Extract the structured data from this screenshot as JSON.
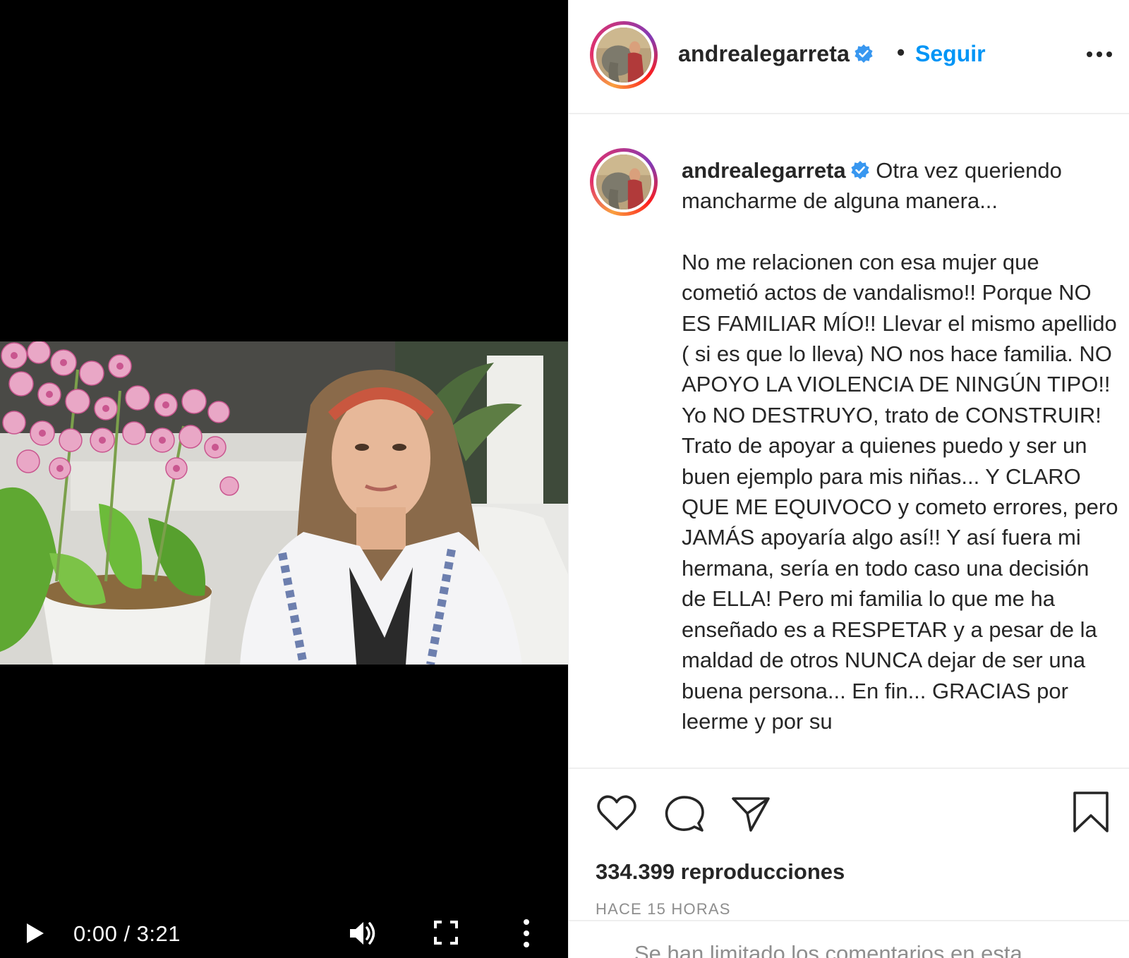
{
  "video": {
    "current_time": "0:00",
    "duration": "3:21",
    "time_display": "0:00 / 3:21",
    "controls": {
      "play_icon": "play-icon",
      "volume_icon": "volume-icon",
      "fullscreen_icon": "fullscreen-icon",
      "more_icon": "more-vertical-icon"
    }
  },
  "header": {
    "username": "andrealegarreta",
    "separator": "•",
    "follow_label": "Seguir",
    "more_icon": "more-horizontal-icon"
  },
  "caption": {
    "username": "andrealegarreta",
    "lead": " Otra vez queriendo mancharme de alguna manera...",
    "body": "No me relacionen con esa mujer que cometió actos de vandalismo!! Porque NO ES FAMILIAR MÍO!! Llevar el mismo apellido ( si es que lo lleva) NO nos hace familia. NO APOYO LA VIOLENCIA DE NINGÚN TIPO!! Yo NO DESTRUYO, trato de CONSTRUIR! Trato de apoyar a quienes puedo y ser un buen ejemplo para mis niñas... Y CLARO QUE ME EQUIVOCO y cometo errores, pero JAMÁS apoyaría algo así!! Y así fuera mi hermana, sería en todo caso una decisión de ELLA! Pero mi familia lo que me ha enseñado es a RESPETAR y a pesar de la maldad de otros NUNCA dejar de ser una buena persona... En fin... GRACIAS por leerme y por su"
  },
  "actions": {
    "views": "334.399 reproducciones",
    "time_ago": "HACE 15 HORAS"
  },
  "comments": {
    "limited_notice": "Se han limitado los comentarios en esta"
  },
  "colors": {
    "accent": "#0095f6",
    "verified": "#3897f0",
    "text": "#262626",
    "muted": "#8e8e8e",
    "divider": "#efefef"
  }
}
